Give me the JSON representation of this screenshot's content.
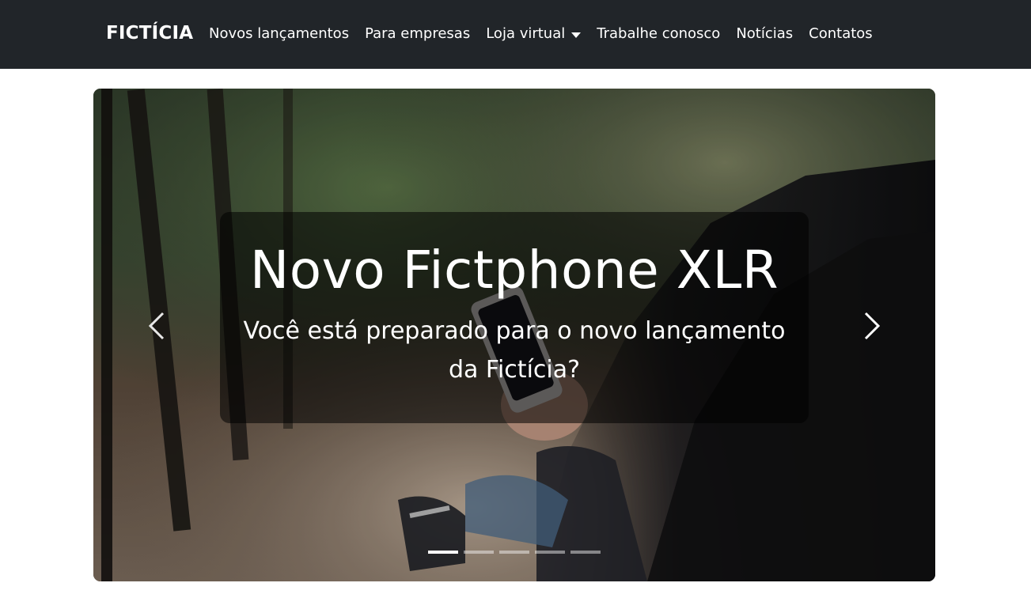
{
  "navbar": {
    "brand": "FICTÍCIA",
    "items": [
      {
        "label": "Novos lançamentos"
      },
      {
        "label": "Para empresas"
      },
      {
        "label": "Loja virtual",
        "dropdown": true
      },
      {
        "label": "Trabalhe conosco"
      },
      {
        "label": "Notícias"
      },
      {
        "label": "Contatos"
      }
    ],
    "colors": {
      "background": "#212529",
      "text": "#ffffff"
    }
  },
  "carousel": {
    "slide": {
      "title": "Novo Fictphone XLR",
      "text": "Você está preparado para o novo lançamento da Fictícia?"
    },
    "controls": {
      "prev_icon": "chevron-left-icon",
      "next_icon": "chevron-right-icon"
    },
    "indicators": {
      "count": 5,
      "active_index": 0
    }
  }
}
